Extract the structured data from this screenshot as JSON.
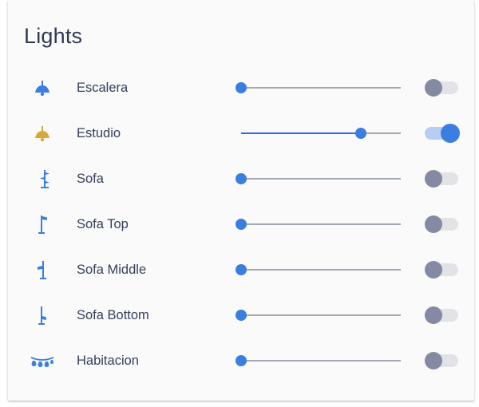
{
  "title": "Lights",
  "colors": {
    "icon_on": "#d7a93c",
    "icon_off": "#3a7fe0",
    "accent": "#3a7fe0",
    "toggle_off": "#838aa2"
  },
  "lights": [
    {
      "name": "Escalera",
      "icon": "ceiling-lamp-icon",
      "brightness": 0,
      "on": false
    },
    {
      "name": "Estudio",
      "icon": "ceiling-lamp-icon",
      "brightness": 0.75,
      "on": true
    },
    {
      "name": "Sofa",
      "icon": "floor-lamp-multi-icon",
      "brightness": 0,
      "on": false
    },
    {
      "name": "Sofa Top",
      "icon": "floor-lamp-top-icon",
      "brightness": 0,
      "on": false
    },
    {
      "name": "Sofa Middle",
      "icon": "floor-lamp-middle-icon",
      "brightness": 0,
      "on": false
    },
    {
      "name": "Sofa Bottom",
      "icon": "floor-lamp-bottom-icon",
      "brightness": 0,
      "on": false
    },
    {
      "name": "Habitacion",
      "icon": "string-lights-icon",
      "brightness": 0,
      "on": false
    }
  ]
}
